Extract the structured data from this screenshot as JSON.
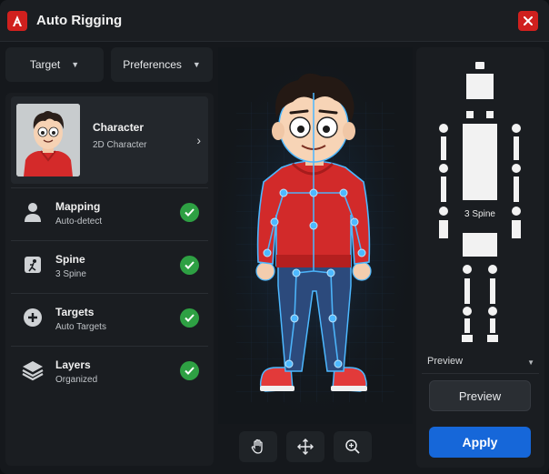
{
  "window": {
    "title": "Auto Rigging"
  },
  "tabs": {
    "target": "Target",
    "preferences": "Preferences"
  },
  "character": {
    "title": "Character",
    "subtitle": "2D Character"
  },
  "steps": [
    {
      "title": "Mapping",
      "subtitle": "Auto-detect",
      "icon": "person-icon",
      "status": "done"
    },
    {
      "title": "Spine",
      "subtitle": "3 Spine",
      "icon": "spine-icon",
      "status": "done"
    },
    {
      "title": "Targets",
      "subtitle": "Auto Targets",
      "icon": "add-target-icon",
      "status": "done"
    },
    {
      "title": "Layers",
      "subtitle": "Organized",
      "icon": "layers-icon",
      "status": "done"
    }
  ],
  "skeleton": {
    "label": "3 Spine"
  },
  "preview": {
    "select_value": "Preview",
    "button": "Preview"
  },
  "apply": {
    "label": "Apply"
  },
  "colors": {
    "accent": "#1667d9",
    "brand": "#d0201e",
    "success": "#2ea043",
    "rig": "#4db8ff"
  }
}
